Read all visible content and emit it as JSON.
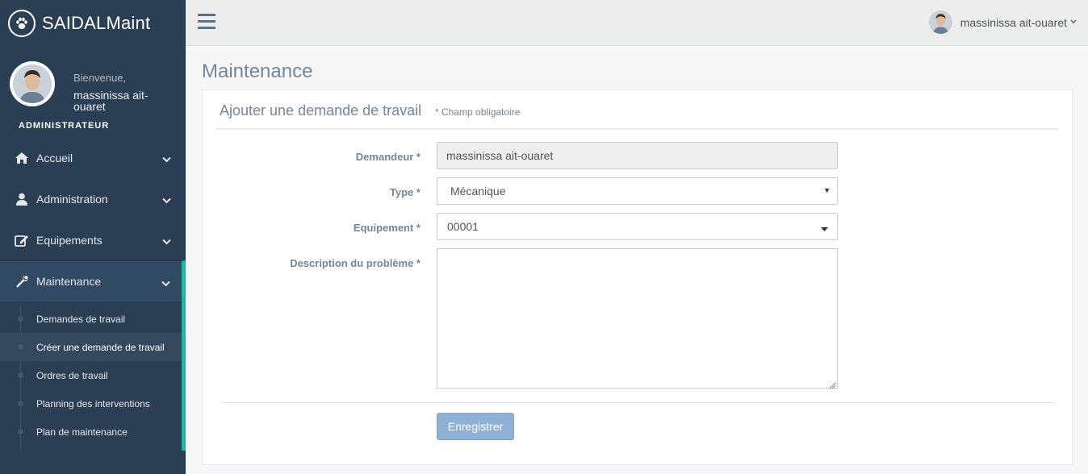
{
  "brand": {
    "title": "SAIDALMaint"
  },
  "profile": {
    "welcome": "Bienvenue,",
    "name": "massinissa ait-ouaret",
    "role": "ADMINISTRATEUR"
  },
  "sidebar": {
    "items": [
      {
        "label": "Accueil",
        "icon": "home-icon"
      },
      {
        "label": "Administration",
        "icon": "user-icon"
      },
      {
        "label": "Equipements",
        "icon": "edit-icon"
      },
      {
        "label": "Maintenance",
        "icon": "wrench-icon"
      }
    ],
    "submenu": [
      {
        "label": "Demandes de travail"
      },
      {
        "label": "Créer une demande de travail"
      },
      {
        "label": "Ordres de travail"
      },
      {
        "label": "Planning des interventions"
      },
      {
        "label": "Plan de maintenance"
      }
    ]
  },
  "topbar": {
    "user_name": "massinissa ait-ouaret"
  },
  "page": {
    "title": "Maintenance"
  },
  "panel": {
    "title": "Ajouter une demande de travail",
    "subtitle": "* Champ obligatoire"
  },
  "form": {
    "demandeur": {
      "label": "Demandeur *",
      "value": "massinissa ait-ouaret"
    },
    "type": {
      "label": "Type *",
      "value": "Mécanique"
    },
    "equipement": {
      "label": "Equipement *",
      "value": "00001"
    },
    "description": {
      "label": "Description du problème *",
      "value": ""
    },
    "submit_label": "Enregistrer"
  },
  "colors": {
    "sidebar_bg": "#2A3F54",
    "accent": "#1ABB9C",
    "button": "#8FB1D6"
  }
}
